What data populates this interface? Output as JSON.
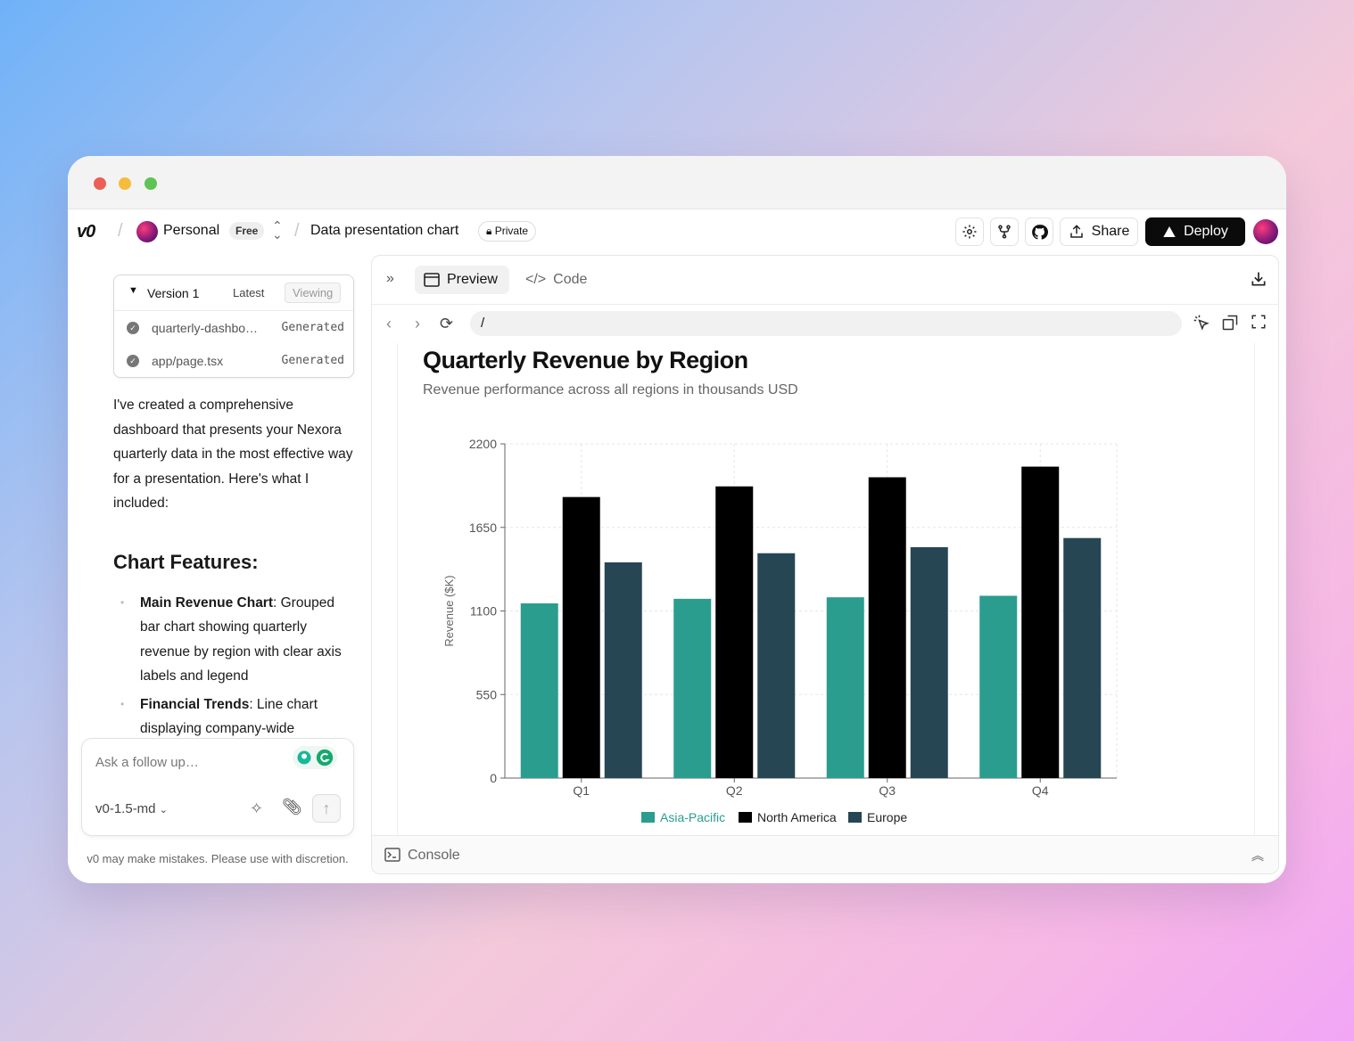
{
  "topbar": {
    "logo": "v0",
    "workspace": "Personal",
    "plan": "Free",
    "project": "Data presentation chart",
    "visibility": "Private",
    "share_label": "Share",
    "deploy_label": "Deploy"
  },
  "versions": {
    "title": "Version 1",
    "latest": "Latest",
    "viewing": "Viewing",
    "files": [
      {
        "name": "quarterly-dashbo…",
        "status": "Generated"
      },
      {
        "name": "app/page.tsx",
        "status": "Generated"
      }
    ]
  },
  "message": {
    "intro": "I've created a comprehensive dashboard that presents your Nexora quarterly data in the most effective way for a presentation. Here's what I included:",
    "heading": "Chart Features:",
    "bullets": [
      {
        "bold": "Main Revenue Chart",
        "text": ": Grouped bar chart showing quarterly revenue by region with clear axis labels and legend"
      },
      {
        "bold": "Financial Trends",
        "text": ": Line chart displaying company-wide"
      }
    ]
  },
  "composer": {
    "placeholder": "Ask a follow up…",
    "model": "v0-1.5-md",
    "disclaimer": "v0 may make mistakes. Please use with discretion."
  },
  "preview_panel": {
    "tab_preview": "Preview",
    "tab_code": "Code",
    "url": "/",
    "console": "Console"
  },
  "chart_data": {
    "type": "bar",
    "title": "Quarterly Revenue by Region",
    "subtitle": "Revenue performance across all regions in thousands USD",
    "ylabel": "Revenue ($K)",
    "xlabel": "",
    "categories": [
      "Q1",
      "Q2",
      "Q3",
      "Q4"
    ],
    "ylim": [
      0,
      2200
    ],
    "yticks": [
      0,
      550,
      1100,
      1650,
      2200
    ],
    "grid": true,
    "legend": "bottom",
    "series": [
      {
        "name": "Asia-Pacific",
        "color": "#2a9d8f",
        "values": [
          1150,
          1180,
          1190,
          1200
        ]
      },
      {
        "name": "North America",
        "color": "#000000",
        "values": [
          1850,
          1920,
          1980,
          2050
        ]
      },
      {
        "name": "Europe",
        "color": "#264653",
        "values": [
          1420,
          1480,
          1520,
          1580
        ]
      }
    ]
  }
}
